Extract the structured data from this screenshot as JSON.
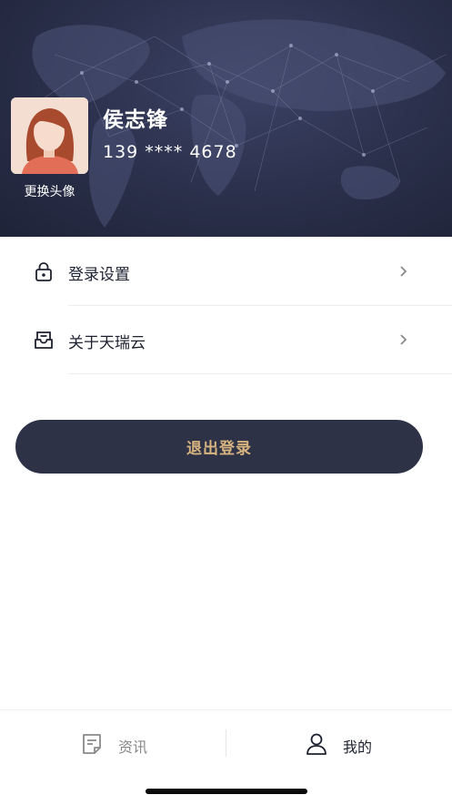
{
  "profile": {
    "name": "侯志锋",
    "phone": "139 **** 4678",
    "change_avatar_label": "更换头像"
  },
  "menu": {
    "items": [
      {
        "id": "login-settings",
        "label": "登录设置",
        "icon": "lock-icon"
      },
      {
        "id": "about",
        "label": "关于天瑞云",
        "icon": "inbox-icon"
      }
    ]
  },
  "actions": {
    "logout_label": "退出登录"
  },
  "tabbar": {
    "tabs": [
      {
        "label": "资讯",
        "icon": "document-icon",
        "active": false
      },
      {
        "label": "我的",
        "icon": "person-icon",
        "active": true
      }
    ]
  },
  "colors": {
    "header_bg": "#2a2f4a",
    "button_bg": "#2e3247",
    "button_text": "#d7b47f",
    "tab_active": "#1e2130",
    "tab_inactive": "#888888"
  }
}
